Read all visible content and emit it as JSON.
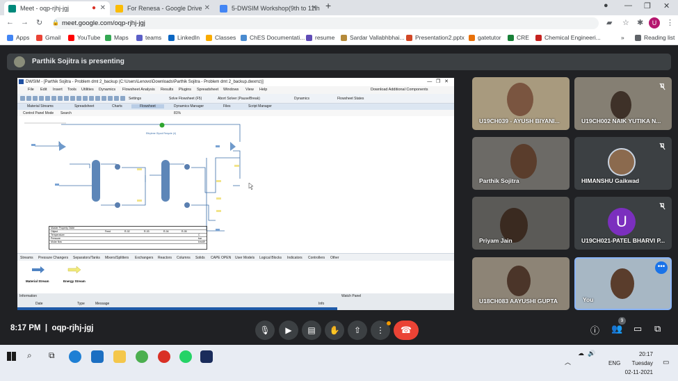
{
  "browser": {
    "tabs": [
      {
        "title": "Meet - oqp-rjhj-jgj",
        "active": true
      },
      {
        "title": "For Renesa - Google Drive",
        "active": false
      },
      {
        "title": "5-DWSIM Workshop(9th to 11th",
        "active": false
      }
    ],
    "new_tab": "+",
    "url": "meet.google.com/oqp-rjhj-jgj",
    "profile_initial": "U",
    "bookmarks": [
      {
        "label": "Apps",
        "color": "#4285f4"
      },
      {
        "label": "Gmail",
        "color": "#ea4335"
      },
      {
        "label": "YouTube",
        "color": "#ff0000"
      },
      {
        "label": "Maps",
        "color": "#34a853"
      },
      {
        "label": "teams",
        "color": "#5b5fc7"
      },
      {
        "label": "LinkedIn",
        "color": "#0a66c2"
      },
      {
        "label": "Classes",
        "color": "#f9ab00"
      },
      {
        "label": "ChES Documentati...",
        "color": "#4a8bd0"
      },
      {
        "label": "resume",
        "color": "#5f4bb6"
      },
      {
        "label": "Sardar Vallabhbhai...",
        "color": "#b58a3a"
      },
      {
        "label": "Presentation2.pptx",
        "color": "#d24726"
      },
      {
        "label": "gatetutor",
        "color": "#e8710a"
      },
      {
        "label": "CRE",
        "color": "#188038"
      },
      {
        "label": "Chemical Engineeri...",
        "color": "#c5221f"
      }
    ],
    "bookmarks_more": "»",
    "reading_list": "Reading list"
  },
  "meet": {
    "presenting_banner": "Parthik Sojitra is presenting",
    "participants": [
      {
        "name": "U19CH039 - AYUSH BIYANI...",
        "muted": false,
        "bg": "#a89a7e"
      },
      {
        "name": "U19CH002 NAIK YUTIKA N...",
        "muted": true,
        "bg": "#857f73"
      },
      {
        "name": "Parthik Sojitra",
        "muted": false,
        "bg": "#6c6a66"
      },
      {
        "name": "HIMANSHU Gaikwad",
        "muted": true,
        "bg": "#3c4043",
        "avatar": "photo"
      },
      {
        "name": "Priyam Jain",
        "muted": false,
        "bg": "#5b5a57"
      },
      {
        "name": "U19CH021-PATEL BHARVI P...",
        "muted": true,
        "bg": "#3c4043",
        "avatar_initial": "U",
        "avatar_color": "#7b2fbe"
      },
      {
        "name": "U18CH083 AAYUSHI GUPTA",
        "muted": false,
        "bg": "#8d8476"
      },
      {
        "name": "You",
        "muted": false,
        "bg": "#a7b7c4",
        "highlighted": true
      }
    ],
    "meeting_time": "8:17 PM",
    "meeting_code": "oqp-rjhj-jgj",
    "participant_count": "9"
  },
  "dwsim": {
    "title": "DWSIM - [Parthik Sojitra - Problem dmt 2_backup (C:\\Users\\Lenovo\\Downloads\\Parthik Sojitra - Problem dmt 2_backup.dwxmz)]",
    "menu": [
      "File",
      "Edit",
      "Insert",
      "Tools",
      "Utilities",
      "Dynamics",
      "Flowsheet Analysis",
      "Results",
      "Plugins",
      "Spreadsheet",
      "Windows",
      "View",
      "Help"
    ],
    "download": "Download Additional Components",
    "toolbar": [
      "Settings",
      "Solve Flowsheet (F5)",
      "Abort Solver (Pause/Break)",
      "Dynamics",
      "Flowsheet States"
    ],
    "doc_tabs": [
      "Material Streams",
      "Spreadsheet",
      "Charts",
      "Flowsheet",
      "Dynamics Manager",
      "Files",
      "Script Manager"
    ],
    "control_panel": "Control Panel Mode",
    "search": "Search",
    "zoom": "81%",
    "recycle_label": "Ethylene Glycol Recycle (4)",
    "table_title": "Master Property Table",
    "table_rows": [
      "Object",
      "Temperature",
      "Pressure",
      "Molar flow"
    ],
    "table_cols": [
      "Feed",
      "R-02",
      "R-03",
      "R-04",
      "R-05"
    ],
    "table_units": [
      "",
      "C",
      "bar",
      "kmol/h"
    ],
    "categories": [
      "Streams",
      "Pressure Changers",
      "Separators/Tanks",
      "Mixers/Splitters",
      "Exchangers",
      "Reactors",
      "Columns",
      "Solids",
      "CAPE OPEN",
      "User Models",
      "Logical Blocks",
      "Indicators",
      "Controllers",
      "Other"
    ],
    "palette": [
      "Material Stream",
      "Energy Stream"
    ],
    "info_panel": "Information",
    "info_cols": [
      "Date",
      "Type",
      "Message",
      "Info"
    ],
    "watch_panel": "Watch Panel"
  },
  "taskbar": {
    "time": "20:17",
    "day": "Tuesday",
    "date": "02-11-2021",
    "lang": "ENG"
  }
}
